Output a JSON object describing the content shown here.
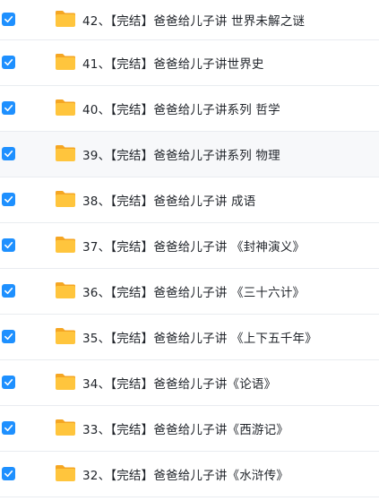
{
  "files": [
    {
      "name": "42、【完结】爸爸给儿子讲 世界未解之谜",
      "checked": true
    },
    {
      "name": "41、【完结】爸爸给儿子讲世界史",
      "checked": true
    },
    {
      "name": "40、【完结】爸爸给儿子讲系列 哲学",
      "checked": true
    },
    {
      "name": "39、【完结】爸爸给儿子讲系列 物理",
      "checked": true
    },
    {
      "name": "38、【完结】爸爸给儿子讲 成语",
      "checked": true
    },
    {
      "name": "37、【完结】爸爸给儿子讲 《封神演义》",
      "checked": true
    },
    {
      "name": "36、【完结】爸爸给儿子讲 《三十六计》",
      "checked": true
    },
    {
      "name": "35、【完结】爸爸给儿子讲 《上下五千年》",
      "checked": true
    },
    {
      "name": "34、【完结】爸爸给儿子讲《论语》",
      "checked": true
    },
    {
      "name": "33、【完结】爸爸给儿子讲《西游记》",
      "checked": true
    },
    {
      "name": "32、【完结】爸爸给儿子讲《水浒传》",
      "checked": true
    }
  ],
  "colors": {
    "checkbox": "#1e90ff",
    "folder_body": "#ffc53d",
    "folder_tab": "#f5a623"
  },
  "icons": {
    "checkbox": "check-icon",
    "folder": "folder-icon"
  }
}
